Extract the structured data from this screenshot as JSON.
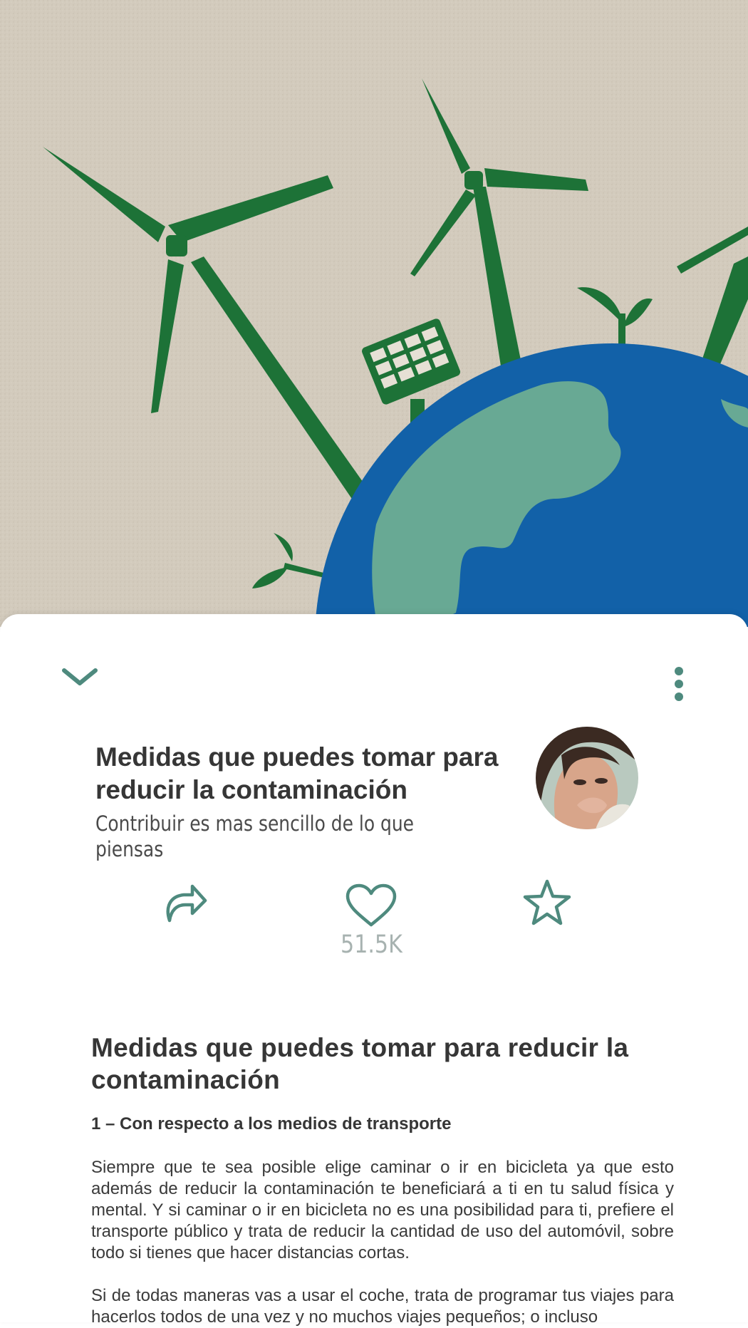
{
  "hero": {
    "image": "wind-turbines-solar-panel-earth-illustration"
  },
  "toolbar": {
    "collapse_icon": "chevron-down-icon",
    "more_icon": "more-vertical-icon"
  },
  "post": {
    "title": "Medidas que puedes tomar para reducir la contaminación",
    "subtitle": "Contribuir es mas sencillo de lo que piensas",
    "author_avatar": "avatar"
  },
  "actions": {
    "share_icon": "share-icon",
    "like_icon": "heart-icon",
    "like_count": "51.5K",
    "favorite_icon": "star-icon"
  },
  "article": {
    "title": "Medidas que puedes tomar para reducir la contaminación",
    "subheading": "1 – Con respecto a los medios de transporte",
    "paragraphs": [
      "Siempre que te sea posible elige caminar o ir en bicicleta ya que esto además de reducir la contaminación te beneficiará a ti en tu salud física y mental. Y si caminar o ir en bicicleta no es una posibilidad para ti, prefiere el transporte público y trata de reducir la cantidad de uso del automóvil, sobre todo si tienes que hacer distancias cortas.",
      "Si de todas maneras vas a usar el coche, trata de programar tus viajes para hacerlos todos de una vez y no muchos viajes pequeños; o incluso"
    ]
  },
  "colors": {
    "accent": "#4e8a7e",
    "turbine_green": "#1d7237",
    "earth_blue": "#1261a8",
    "land": "#68a994",
    "paper": "#d3cbbd"
  }
}
